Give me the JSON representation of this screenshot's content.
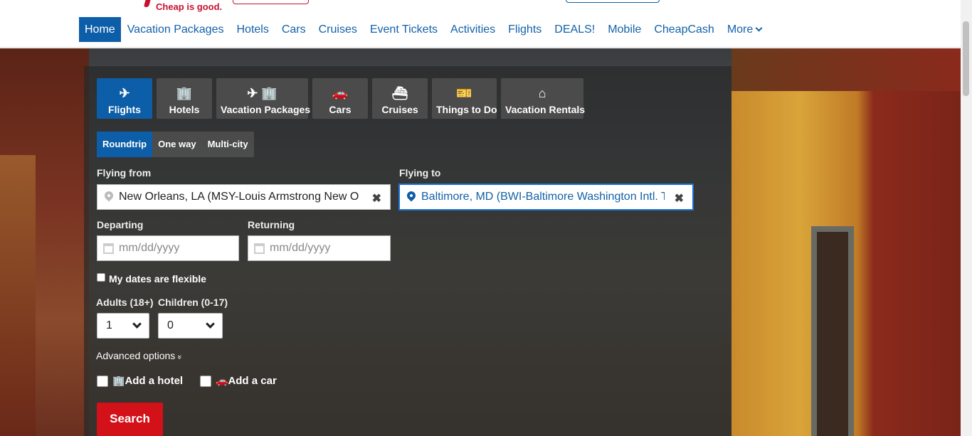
{
  "header": {
    "tagline": "Cheap is good."
  },
  "nav": {
    "items": [
      "Home",
      "Vacation Packages",
      "Hotels",
      "Cars",
      "Cruises",
      "Event Tickets",
      "Activities",
      "Flights",
      "DEALS!",
      "Mobile",
      "CheapCash"
    ],
    "more_label": "More"
  },
  "search": {
    "tabs": [
      {
        "label": "Flights",
        "icon": "✈"
      },
      {
        "label": "Hotels",
        "icon": "🏢"
      },
      {
        "label": "Vacation Packages",
        "icon": "✈ 🏢"
      },
      {
        "label": "Cars",
        "icon": "🚗"
      },
      {
        "label": "Cruises",
        "icon": "⛴"
      },
      {
        "label": "Things to Do",
        "icon": "🎫"
      },
      {
        "label": "Vacation Rentals",
        "icon": "⌂"
      }
    ],
    "trip_types": [
      "Roundtrip",
      "One way",
      "Multi-city"
    ],
    "from_label": "Flying from",
    "from_value": "New Orleans, LA (MSY-Louis Armstrong New O",
    "to_label": "Flying to",
    "to_value": "Baltimore, MD (BWI-Baltimore Washington Intl. T",
    "depart_label": "Departing",
    "depart_placeholder": "mm/dd/yyyy",
    "return_label": "Returning",
    "return_placeholder": "mm/dd/yyyy",
    "flexible_label": "My dates are flexible",
    "adults_label": "Adults (18+)",
    "adults_value": "1",
    "children_label": "Children (0-17)",
    "children_value": "0",
    "advanced_label": "Advanced options",
    "advanced_chev": "»",
    "add_hotel_label": "Add a hotel",
    "add_car_label": "Add a car",
    "search_button": "Search",
    "clear_glyph": "✖"
  }
}
